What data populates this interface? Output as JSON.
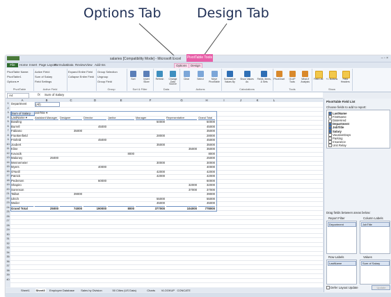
{
  "callouts": {
    "options": "Options Tab",
    "design": "Design Tab"
  },
  "window": {
    "title": "salaries [Compatibility Mode] - Microsoft Excel",
    "context_tab": "PivotTable Tools",
    "controls": "– ▫ ×"
  },
  "ribbon_tabs": [
    "File",
    "Home",
    "Insert",
    "Page Layout",
    "Formulas",
    "Data",
    "Review",
    "View",
    "Add-Ins",
    "Options",
    "Design"
  ],
  "ribbon_groups": [
    {
      "caption": "PivotTable",
      "lines": [
        "PivotTable Name:",
        "PivotTable1",
        "Options ▾"
      ]
    },
    {
      "caption": "Active Field",
      "lines": [
        "Active Field:",
        "Sum of Salary",
        "Field Settings"
      ]
    },
    {
      "caption": "",
      "lines": [
        "Expand Entire Field",
        "Collapse Entire Field"
      ]
    },
    {
      "caption": "Group",
      "lines": [
        "Group Selection",
        "Ungroup",
        "Group Field"
      ]
    },
    {
      "caption": "Sort & Filter",
      "lines": [
        "Sort",
        "Insert Slicer"
      ]
    },
    {
      "caption": "Data",
      "lines": [
        "Refresh",
        "Change Data Source"
      ]
    },
    {
      "caption": "Actions",
      "lines": [
        "Clear",
        "Select",
        "Move PivotTable"
      ]
    },
    {
      "caption": "Calculations",
      "lines": [
        "Summarize Values By",
        "Show Values As",
        "Fields, Items, & Sets"
      ]
    },
    {
      "caption": "Tools",
      "lines": [
        "PivotChart",
        "OLAP Tools",
        "What-If Analysis"
      ]
    },
    {
      "caption": "Show",
      "lines": [
        "Field List",
        "+/- Buttons",
        "Field Headers"
      ]
    }
  ],
  "formula_bar": {
    "name_box": "A4",
    "fx": "fx",
    "value": "Sum of Salary"
  },
  "columns": [
    "A",
    "B",
    "C",
    "D",
    "E",
    "F",
    "G",
    "H",
    "I",
    "J",
    "K",
    "L"
  ],
  "pivot": {
    "filter_label": "Department",
    "filter_value": "(All)",
    "corner": "Sum of Salary",
    "col_label": "JobTitle",
    "row_label": "LastName",
    "headers": [
      "Assistant Manager",
      "Designer",
      "Director",
      "Janitor",
      "Manager",
      "Representative",
      "Grand Total"
    ],
    "rows": [
      {
        "name": "Bowling",
        "vals": [
          "",
          "",
          "",
          "",
          "50000",
          "",
          "50000"
        ]
      },
      {
        "name": "Burrell",
        "vals": [
          "",
          "",
          "45000",
          "",
          "",
          "",
          "45000"
        ]
      },
      {
        "name": "Fabiano",
        "vals": [
          "",
          "35000",
          "",
          "",
          "",
          "",
          "35000"
        ]
      },
      {
        "name": "Frankenfield",
        "vals": [
          "",
          "",
          "",
          "",
          "28000",
          "",
          "28000"
        ]
      },
      {
        "name": "Frisfeld",
        "vals": [
          "",
          "",
          "45000",
          "",
          "",
          "",
          "45000"
        ]
      },
      {
        "name": "Joubert",
        "vals": [
          "",
          "",
          "",
          "",
          "35000",
          "",
          "35000"
        ]
      },
      {
        "name": "Kline",
        "vals": [
          "",
          "",
          "",
          "",
          "",
          "35000",
          "35000"
        ]
      },
      {
        "name": "Kovacik",
        "vals": [
          "",
          "",
          "",
          "8000",
          "",
          "",
          "8000"
        ]
      },
      {
        "name": "Maloney",
        "vals": [
          "25000",
          "",
          "",
          "",
          "",
          "",
          "25000"
        ]
      },
      {
        "name": "Mennemeier",
        "vals": [
          "",
          "",
          "",
          "",
          "30000",
          "",
          "30000"
        ]
      },
      {
        "name": "Myers",
        "vals": [
          "",
          "",
          "40000",
          "",
          "",
          "",
          "40000"
        ]
      },
      {
        "name": "O'Neill",
        "vals": [
          "",
          "",
          "",
          "",
          "42000",
          "",
          "42000"
        ]
      },
      {
        "name": "Patrick",
        "vals": [
          "",
          "",
          "",
          "",
          "42000",
          "",
          "42000"
        ]
      },
      {
        "name": "Pedersen",
        "vals": [
          "",
          "",
          "60000",
          "",
          "",
          "",
          "60000"
        ]
      },
      {
        "name": "Shapiro",
        "vals": [
          "",
          "",
          "",
          "",
          "",
          "32000",
          "32000"
        ]
      },
      {
        "name": "Sorenson",
        "vals": [
          "",
          "",
          "",
          "",
          "",
          "37000",
          "37000"
        ]
      },
      {
        "name": "Talbot",
        "vals": [
          "",
          "39000",
          "",
          "",
          "",
          "",
          "39000"
        ]
      },
      {
        "name": "Ulrich",
        "vals": [
          "",
          "",
          "",
          "",
          "55000",
          "",
          "55000"
        ]
      },
      {
        "name": "Weiler",
        "vals": [
          "",
          "",
          "",
          "",
          "45000",
          "",
          "45000"
        ]
      }
    ],
    "grand_total": {
      "name": "Grand Total",
      "vals": [
        "25000",
        "74000",
        "190000",
        "8000",
        "377000",
        "104000",
        "778000"
      ]
    }
  },
  "sheet_tabs": [
    "Sheet1",
    "Sheet3",
    "Employee Database",
    "Sales by Division",
    "50 Cities (US Data)",
    "Charts",
    "VLOOKUP",
    "CONCATE"
  ],
  "field_list": {
    "title": "PivotTable Field List",
    "choose_label": "Choose fields to add to report:",
    "fields": [
      {
        "name": "LastName",
        "checked": true
      },
      {
        "name": "FirstName",
        "checked": false
      },
      {
        "name": "DateHired",
        "checked": false
      },
      {
        "name": "Department",
        "checked": true
      },
      {
        "name": "JobTitle",
        "checked": true
      },
      {
        "name": "Salary",
        "checked": true
      },
      {
        "name": "VacationDays",
        "checked": false
      },
      {
        "name": "Parking",
        "checked": false
      },
      {
        "name": "Insurance",
        "checked": false
      },
      {
        "name": "Unit Relay",
        "checked": false
      }
    ],
    "drag_label": "Drag fields between areas below:",
    "areas": {
      "report_filter": "Report Filter",
      "column_labels": "Column Labels",
      "row_labels": "Row Labels",
      "values": "Values",
      "filter_item": "Department",
      "column_item": "JobTitle",
      "row_item": "LastName",
      "values_item": "Sum of Salary"
    },
    "defer": "Defer Layout Update",
    "update": "Update"
  }
}
